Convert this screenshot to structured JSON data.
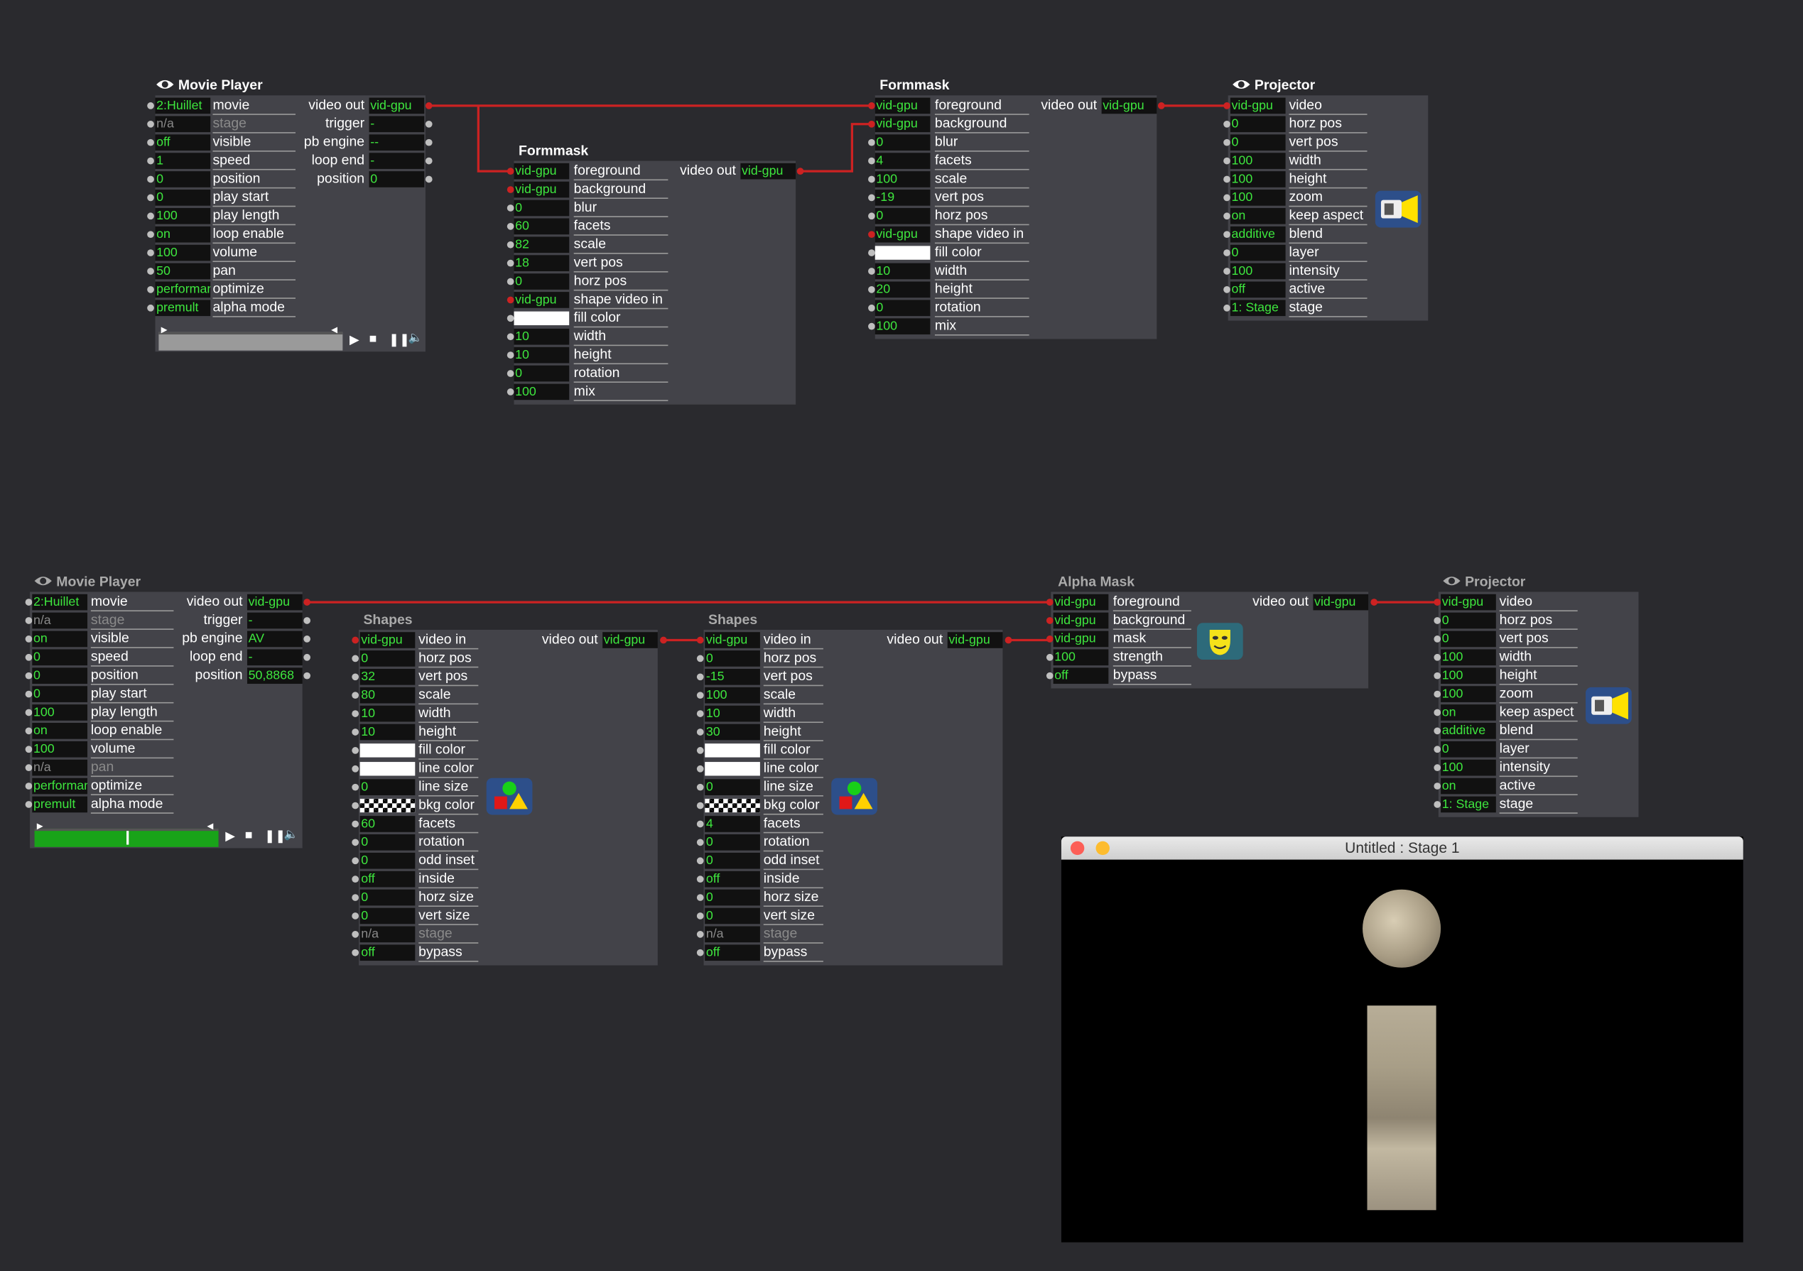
{
  "colors": {
    "background": "#2a2a2e",
    "panel": "#434349",
    "value_text": "#3ee63e",
    "connection": "#cc2222"
  },
  "top_movie_player": {
    "title": "Movie Player",
    "inputs": [
      {
        "value": "2:Huillet",
        "label": "movie"
      },
      {
        "value": "n/a",
        "label": "stage",
        "dim": true
      },
      {
        "value": "off",
        "label": "visible"
      },
      {
        "value": "1",
        "label": "speed"
      },
      {
        "value": "0",
        "label": "position"
      },
      {
        "value": "0",
        "label": "play start"
      },
      {
        "value": "100",
        "label": "play length"
      },
      {
        "value": "on",
        "label": "loop enable"
      },
      {
        "value": "100",
        "label": "volume"
      },
      {
        "value": "50",
        "label": "pan"
      },
      {
        "value": "performance",
        "label": "optimize"
      },
      {
        "value": "premult",
        "label": "alpha mode"
      }
    ],
    "outputs": [
      {
        "label": "video out",
        "value": "vid-gpu"
      },
      {
        "label": "trigger",
        "value": "-"
      },
      {
        "label": "pb engine",
        "value": "--"
      },
      {
        "label": "loop end",
        "value": "-"
      },
      {
        "label": "position",
        "value": "0"
      }
    ],
    "progress": 0
  },
  "formmask_1": {
    "title": "Formmask",
    "inputs": [
      {
        "value": "vid-gpu",
        "label": "foreground"
      },
      {
        "value": "vid-gpu",
        "label": "background"
      },
      {
        "value": "0",
        "label": "blur"
      },
      {
        "value": "60",
        "label": "facets"
      },
      {
        "value": "82",
        "label": "scale"
      },
      {
        "value": "18",
        "label": "vert pos"
      },
      {
        "value": "0",
        "label": "horz pos"
      },
      {
        "value": "vid-gpu",
        "label": "shape video in"
      },
      {
        "value": "",
        "label": "fill color",
        "swatch": true
      },
      {
        "value": "10",
        "label": "width"
      },
      {
        "value": "10",
        "label": "height"
      },
      {
        "value": "0",
        "label": "rotation"
      },
      {
        "value": "100",
        "label": "mix"
      }
    ],
    "outputs": [
      {
        "label": "video out",
        "value": "vid-gpu"
      }
    ]
  },
  "formmask_2": {
    "title": "Formmask",
    "inputs": [
      {
        "value": "vid-gpu",
        "label": "foreground"
      },
      {
        "value": "vid-gpu",
        "label": "background"
      },
      {
        "value": "0",
        "label": "blur"
      },
      {
        "value": "4",
        "label": "facets"
      },
      {
        "value": "100",
        "label": "scale"
      },
      {
        "value": "-19",
        "label": "vert pos"
      },
      {
        "value": "0",
        "label": "horz pos"
      },
      {
        "value": "vid-gpu",
        "label": "shape video in"
      },
      {
        "value": "",
        "label": "fill color",
        "swatch": true
      },
      {
        "value": "10",
        "label": "width"
      },
      {
        "value": "20",
        "label": "height"
      },
      {
        "value": "0",
        "label": "rotation"
      },
      {
        "value": "100",
        "label": "mix"
      }
    ],
    "outputs": [
      {
        "label": "video out",
        "value": "vid-gpu"
      }
    ]
  },
  "top_projector": {
    "title": "Projector",
    "inputs": [
      {
        "value": "vid-gpu",
        "label": "video"
      },
      {
        "value": "0",
        "label": "horz pos"
      },
      {
        "value": "0",
        "label": "vert pos"
      },
      {
        "value": "100",
        "label": "width"
      },
      {
        "value": "100",
        "label": "height"
      },
      {
        "value": "100",
        "label": "zoom"
      },
      {
        "value": "on",
        "label": "keep aspect"
      },
      {
        "value": "additive",
        "label": "blend"
      },
      {
        "value": "0",
        "label": "layer"
      },
      {
        "value": "100",
        "label": "intensity"
      },
      {
        "value": "off",
        "label": "active"
      },
      {
        "value": "1: Stage",
        "label": "stage"
      }
    ],
    "icon": "projector-icon"
  },
  "bottom_movie_player": {
    "title": "Movie Player",
    "inputs": [
      {
        "value": "2:Huillet",
        "label": "movie"
      },
      {
        "value": "n/a",
        "label": "stage",
        "dim": true
      },
      {
        "value": "on",
        "label": "visible"
      },
      {
        "value": "0",
        "label": "speed"
      },
      {
        "value": "0",
        "label": "position"
      },
      {
        "value": "0",
        "label": "play start"
      },
      {
        "value": "100",
        "label": "play length"
      },
      {
        "value": "on",
        "label": "loop enable"
      },
      {
        "value": "100",
        "label": "volume"
      },
      {
        "value": "n/a",
        "label": "pan",
        "dim": true
      },
      {
        "value": "performance",
        "label": "optimize"
      },
      {
        "value": "premult",
        "label": "alpha mode"
      }
    ],
    "outputs": [
      {
        "label": "video out",
        "value": "vid-gpu"
      },
      {
        "label": "trigger",
        "value": "-"
      },
      {
        "label": "pb engine",
        "value": "AV"
      },
      {
        "label": "loop end",
        "value": "-"
      },
      {
        "label": "position",
        "value": "50,8868"
      }
    ],
    "progress": 0.5
  },
  "shapes_1": {
    "title": "Shapes",
    "inputs": [
      {
        "value": "vid-gpu",
        "label": "video in"
      },
      {
        "value": "0",
        "label": "horz pos"
      },
      {
        "value": "32",
        "label": "vert pos"
      },
      {
        "value": "80",
        "label": "scale"
      },
      {
        "value": "10",
        "label": "width"
      },
      {
        "value": "10",
        "label": "height"
      },
      {
        "value": "",
        "label": "fill color",
        "swatch": true
      },
      {
        "value": "",
        "label": "line color",
        "swatch": true
      },
      {
        "value": "0",
        "label": "line size"
      },
      {
        "value": "",
        "label": "bkg color",
        "checker": true
      },
      {
        "value": "60",
        "label": "facets"
      },
      {
        "value": "0",
        "label": "rotation"
      },
      {
        "value": "0",
        "label": "odd inset"
      },
      {
        "value": "off",
        "label": "inside"
      },
      {
        "value": "0",
        "label": "horz size"
      },
      {
        "value": "0",
        "label": "vert size"
      },
      {
        "value": "n/a",
        "label": "stage",
        "dim": true
      },
      {
        "value": "off",
        "label": "bypass"
      }
    ],
    "outputs": [
      {
        "label": "video out",
        "value": "vid-gpu"
      }
    ],
    "icon": "shapes-icon"
  },
  "shapes_2": {
    "title": "Shapes",
    "inputs": [
      {
        "value": "vid-gpu",
        "label": "video in"
      },
      {
        "value": "0",
        "label": "horz pos"
      },
      {
        "value": "-15",
        "label": "vert pos"
      },
      {
        "value": "100",
        "label": "scale"
      },
      {
        "value": "10",
        "label": "width"
      },
      {
        "value": "30",
        "label": "height"
      },
      {
        "value": "",
        "label": "fill color",
        "swatch": true
      },
      {
        "value": "",
        "label": "line color",
        "swatch": true
      },
      {
        "value": "0",
        "label": "line size"
      },
      {
        "value": "",
        "label": "bkg color",
        "checker": true
      },
      {
        "value": "4",
        "label": "facets"
      },
      {
        "value": "0",
        "label": "rotation"
      },
      {
        "value": "0",
        "label": "odd inset"
      },
      {
        "value": "off",
        "label": "inside"
      },
      {
        "value": "0",
        "label": "horz size"
      },
      {
        "value": "0",
        "label": "vert size"
      },
      {
        "value": "n/a",
        "label": "stage",
        "dim": true
      },
      {
        "value": "off",
        "label": "bypass"
      }
    ],
    "outputs": [
      {
        "label": "video out",
        "value": "vid-gpu"
      }
    ],
    "icon": "shapes-icon"
  },
  "alpha_mask": {
    "title": "Alpha Mask",
    "inputs": [
      {
        "value": "vid-gpu",
        "label": "foreground"
      },
      {
        "value": "vid-gpu",
        "label": "background"
      },
      {
        "value": "vid-gpu",
        "label": "mask"
      },
      {
        "value": "100",
        "label": "strength"
      },
      {
        "value": "off",
        "label": "bypass"
      }
    ],
    "outputs": [
      {
        "label": "video out",
        "value": "vid-gpu"
      }
    ],
    "icon": "mask-icon"
  },
  "bottom_projector": {
    "title": "Projector",
    "inputs": [
      {
        "value": "vid-gpu",
        "label": "video"
      },
      {
        "value": "0",
        "label": "horz pos"
      },
      {
        "value": "0",
        "label": "vert pos"
      },
      {
        "value": "100",
        "label": "width"
      },
      {
        "value": "100",
        "label": "height"
      },
      {
        "value": "100",
        "label": "zoom"
      },
      {
        "value": "on",
        "label": "keep aspect"
      },
      {
        "value": "additive",
        "label": "blend"
      },
      {
        "value": "0",
        "label": "layer"
      },
      {
        "value": "100",
        "label": "intensity"
      },
      {
        "value": "on",
        "label": "active"
      },
      {
        "value": "1: Stage",
        "label": "stage"
      }
    ],
    "icon": "projector-icon"
  },
  "stage_window": {
    "title": "Untitled : Stage 1"
  }
}
